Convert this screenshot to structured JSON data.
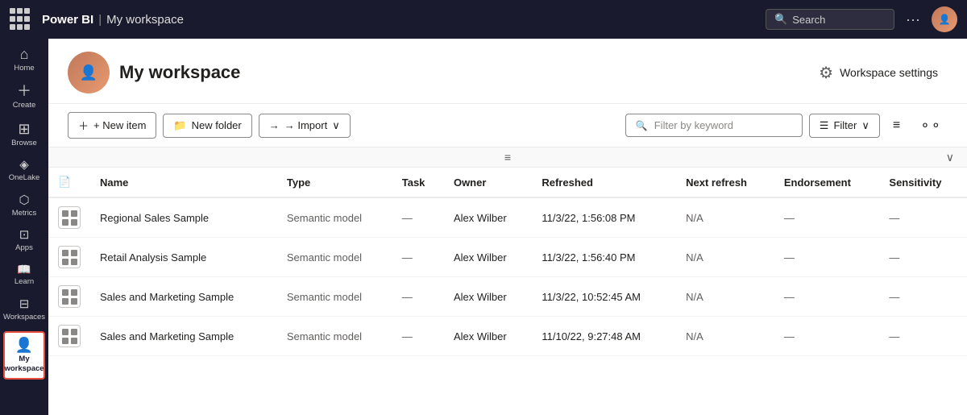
{
  "topNav": {
    "appName": "Power BI",
    "workspaceName": "My workspace",
    "searchPlaceholder": "Search",
    "moreLabel": "···"
  },
  "sidebar": {
    "items": [
      {
        "id": "home",
        "label": "Home",
        "icon": "⌂"
      },
      {
        "id": "create",
        "label": "Create",
        "icon": "+"
      },
      {
        "id": "browse",
        "label": "Browse",
        "icon": "⊞"
      },
      {
        "id": "onelake",
        "label": "OneLake",
        "icon": "◈"
      },
      {
        "id": "metrics",
        "label": "Metrics",
        "icon": "⬡"
      },
      {
        "id": "apps",
        "label": "Apps",
        "icon": "⊡"
      },
      {
        "id": "learn",
        "label": "Learn",
        "icon": "📖"
      },
      {
        "id": "workspaces",
        "label": "Workspaces",
        "icon": "⊟"
      }
    ],
    "bottomItem": {
      "id": "my-workspace",
      "label": "My workspace",
      "icon": "👤"
    }
  },
  "workspaceHeader": {
    "title": "My workspace",
    "settingsLabel": "Workspace settings"
  },
  "toolbar": {
    "newItemLabel": "+ New item",
    "newFolderLabel": "New folder",
    "importLabel": "→ Import",
    "filterPlaceholder": "Filter by keyword",
    "filterLabel": "Filter"
  },
  "table": {
    "columns": [
      {
        "id": "icon",
        "label": ""
      },
      {
        "id": "name",
        "label": "Name"
      },
      {
        "id": "type",
        "label": "Type"
      },
      {
        "id": "task",
        "label": "Task"
      },
      {
        "id": "owner",
        "label": "Owner"
      },
      {
        "id": "refreshed",
        "label": "Refreshed"
      },
      {
        "id": "next-refresh",
        "label": "Next refresh"
      },
      {
        "id": "endorsement",
        "label": "Endorsement"
      },
      {
        "id": "sensitivity",
        "label": "Sensitivity"
      }
    ],
    "rows": [
      {
        "name": "Regional Sales Sample",
        "type": "Semantic model",
        "task": "—",
        "owner": "Alex Wilber",
        "refreshed": "11/3/22, 1:56:08 PM",
        "nextRefresh": "N/A",
        "endorsement": "—",
        "sensitivity": "—"
      },
      {
        "name": "Retail Analysis Sample",
        "type": "Semantic model",
        "task": "—",
        "owner": "Alex Wilber",
        "refreshed": "11/3/22, 1:56:40 PM",
        "nextRefresh": "N/A",
        "endorsement": "—",
        "sensitivity": "—"
      },
      {
        "name": "Sales and Marketing Sample",
        "type": "Semantic model",
        "task": "—",
        "owner": "Alex Wilber",
        "refreshed": "11/3/22, 10:52:45 AM",
        "nextRefresh": "N/A",
        "endorsement": "—",
        "sensitivity": "—"
      },
      {
        "name": "Sales and Marketing Sample",
        "type": "Semantic model",
        "task": "—",
        "owner": "Alex Wilber",
        "refreshed": "11/10/22, 9:27:48 AM",
        "nextRefresh": "N/A",
        "endorsement": "—",
        "sensitivity": "—"
      }
    ]
  }
}
